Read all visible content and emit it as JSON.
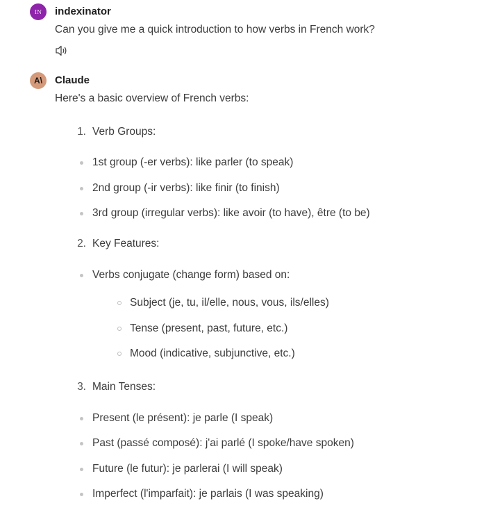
{
  "user_message": {
    "avatar_initials": "IN",
    "name": "indexinator",
    "text": "Can you give me a quick introduction to how verbs in French work?",
    "speaker_icon": "speaker-icon"
  },
  "assistant_message": {
    "avatar_logo": "A\\",
    "name": "Claude",
    "intro": "Here's a basic overview of French verbs:",
    "sections": [
      {
        "number": "1.",
        "title": "Verb Groups:",
        "bullets": [
          "1st group (-er verbs): like parler (to speak)",
          "2nd group (-ir verbs): like finir (to finish)",
          "3rd group (irregular verbs): like avoir (to have), être (to be)"
        ]
      },
      {
        "number": "2.",
        "title": "Key Features:",
        "bullets": [
          "Verbs conjugate (change form) based on:"
        ],
        "sub_bullets": [
          "Subject (je, tu, il/elle, nous, vous, ils/elles)",
          "Tense (present, past, future, etc.)",
          "Mood (indicative, subjunctive, etc.)"
        ]
      },
      {
        "number": "3.",
        "title": "Main Tenses:",
        "bullets": [
          "Present (le présent): je parle (I speak)",
          "Past (passé composé): j'ai parlé (I spoke/have spoken)",
          "Future (le futur): je parlerai (I will speak)",
          "Imperfect (l'imparfait): je parlais (I was speaking)"
        ]
      }
    ]
  }
}
